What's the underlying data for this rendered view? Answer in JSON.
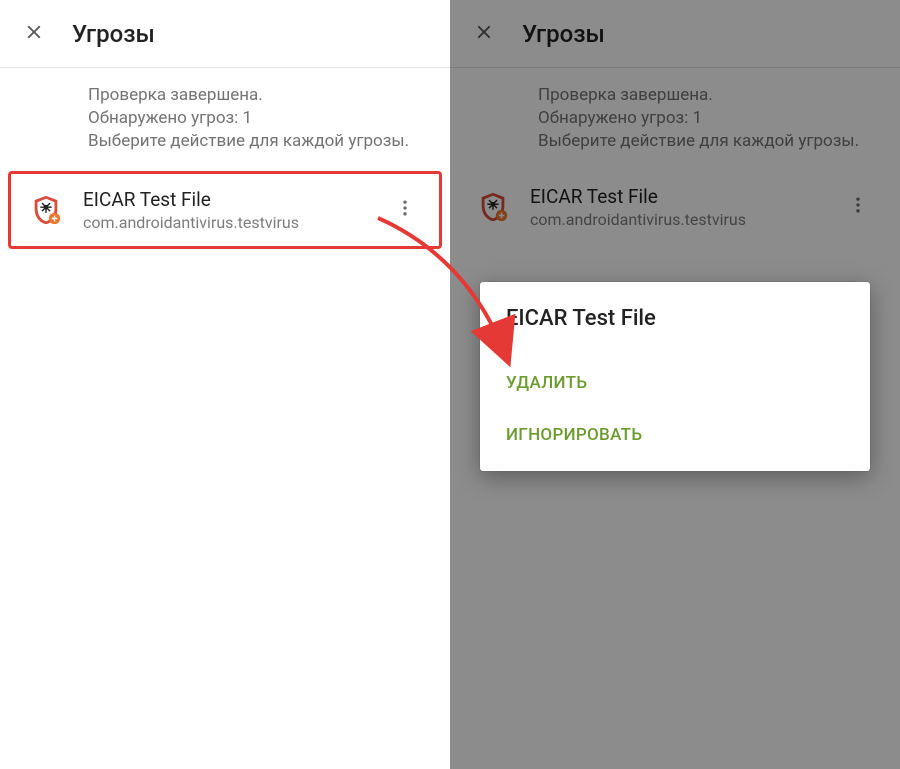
{
  "left": {
    "title": "Угрозы",
    "status_lines": [
      "Проверка завершена.",
      "Обнаружено угроз: 1",
      "Выберите действие для каждой угрозы."
    ],
    "threat": {
      "name": "EICAR Test File",
      "package": "com.androidantivirus.testvirus"
    }
  },
  "right": {
    "title": "Угрозы",
    "status_lines": [
      "Проверка завершена.",
      "Обнаружено угроз: 1",
      "Выберите действие для каждой угрозы."
    ],
    "threat": {
      "name": "EICAR Test File",
      "package": "com.androidantivirus.testvirus"
    },
    "popup": {
      "title": "EICAR Test File",
      "action_delete": "УДАЛИТЬ",
      "action_ignore": "ИГНОРИРОВАТЬ"
    }
  },
  "colors": {
    "highlight": "#e53935",
    "action": "#6b9b2f"
  }
}
